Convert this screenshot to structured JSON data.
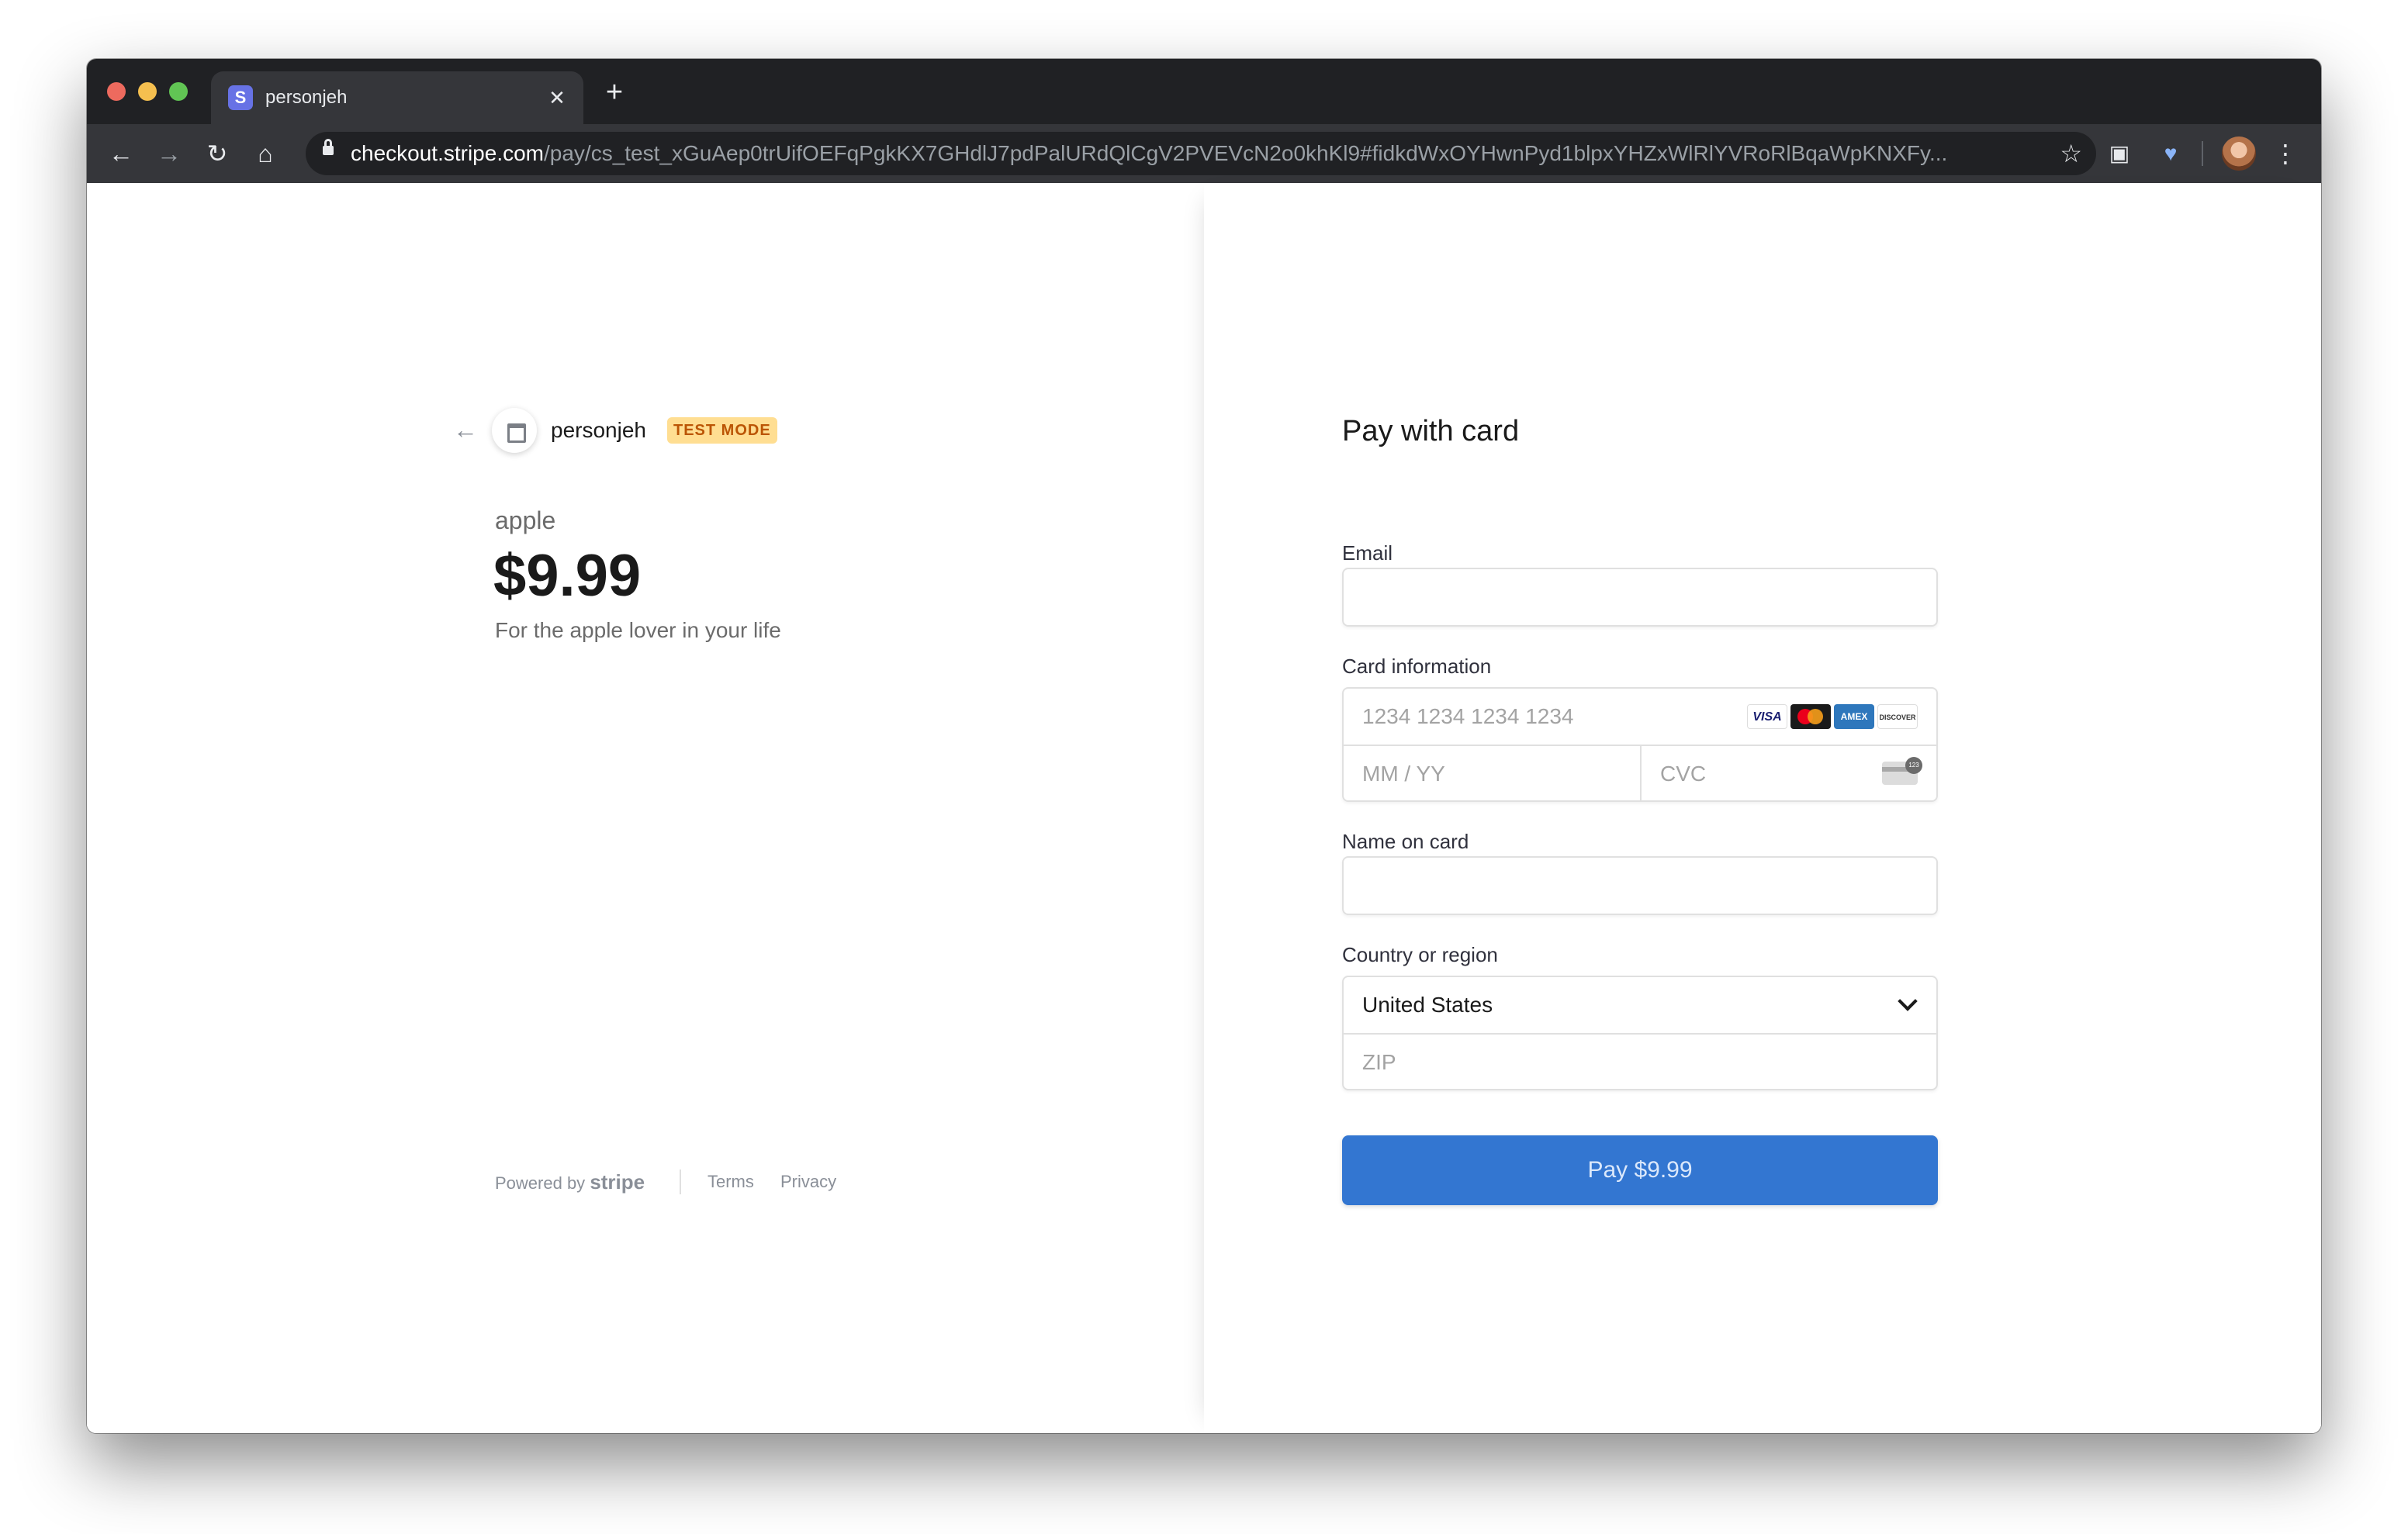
{
  "browser": {
    "tab": {
      "title": "personjeh",
      "favicon_letter": "S",
      "close_label": "✕"
    },
    "new_tab_label": "+",
    "url": {
      "host": "checkout.stripe.com",
      "path": "/pay/cs_test_xGuAep0trUifOEFqPgkKX7GHdlJ7pdPalURdQlCgV2PVEVcN2o0khKl9#fidkdWxOYHwnPyd1blpxYHZxWlRlYVRoRlBqaWpKNXFy..."
    },
    "nav": {
      "back": "←",
      "forward": "→",
      "reload": "↻",
      "home": "⌂"
    },
    "icons": [
      "lock-icon",
      "star-icon",
      "extension-icon",
      "extension-heart-icon",
      "avatar",
      "menu-icon"
    ]
  },
  "merchant": {
    "name": "personjeh",
    "badge": "TEST MODE",
    "back_icon": "←"
  },
  "product": {
    "name": "apple",
    "price": "$9.99",
    "description": "For the apple lover in your life"
  },
  "footer": {
    "powered_by": "Powered by",
    "brand": "stripe",
    "terms": "Terms",
    "privacy": "Privacy"
  },
  "form": {
    "title": "Pay with card",
    "email_label": "Email",
    "email_value": "",
    "card_label": "Card information",
    "card_number_placeholder": "1234 1234 1234 1234",
    "expiry_placeholder": "MM / YY",
    "cvc_placeholder": "CVC",
    "card_brands": [
      "VISA",
      "Mastercard",
      "AMEX",
      "DISCOVER"
    ],
    "name_label": "Name on card",
    "name_value": "",
    "country_label": "Country or region",
    "country_selected": "United States",
    "zip_placeholder": "ZIP",
    "pay_label": "Pay $9.99"
  },
  "colors": {
    "pay_button": "#3376d1",
    "test_badge_bg": "#ffde92",
    "test_badge_text": "#bb5504",
    "chrome_dark": "#202124"
  }
}
